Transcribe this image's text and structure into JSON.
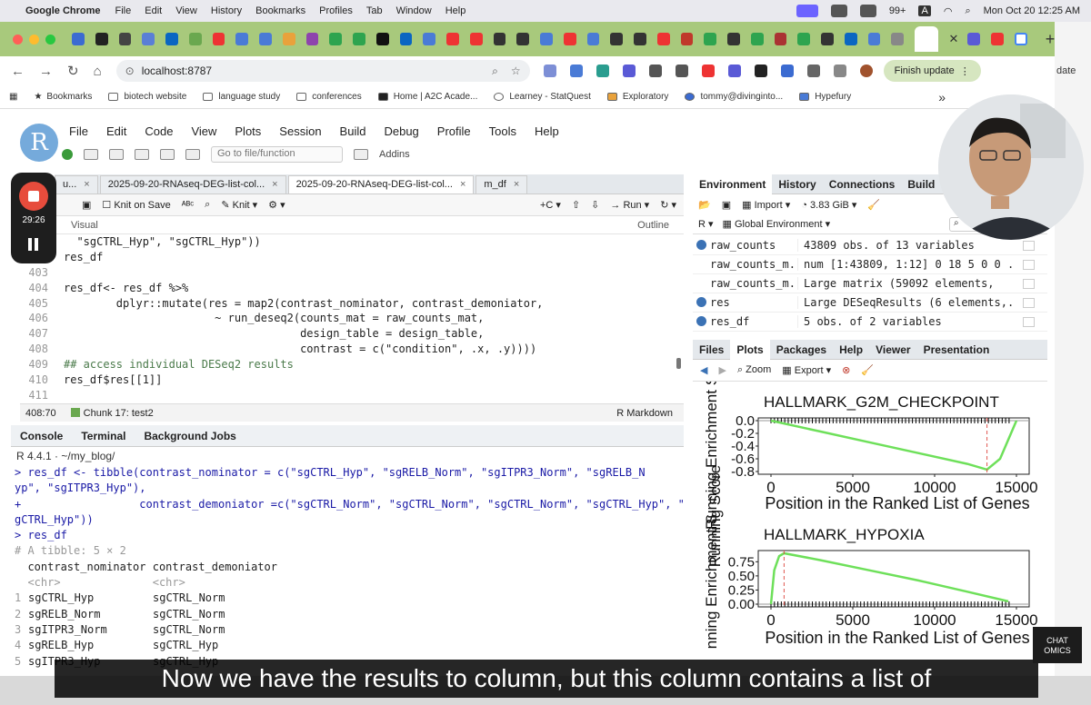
{
  "macbar": {
    "app": "Google Chrome",
    "menus": [
      "File",
      "Edit",
      "View",
      "History",
      "Bookmarks",
      "Profiles",
      "Tab",
      "Window",
      "Help"
    ],
    "notif_count": "99+",
    "input_source": "A",
    "datetime": "Mon Oct 20  12:25 AM"
  },
  "chrome": {
    "url": "localhost:8787",
    "finish_update": "Finish update",
    "partial_right": "date",
    "bookmarks": [
      "Bookmarks",
      "biotech website",
      "language study",
      "conferences",
      "Home | A2C Acade...",
      "Learney - StatQuest",
      "Exploratory",
      "tommy@divinginto...",
      "Hypefury"
    ],
    "more": "»"
  },
  "rstudio": {
    "menus": [
      "File",
      "Edit",
      "Code",
      "View",
      "Plots",
      "Session",
      "Build",
      "Debug",
      "Profile",
      "Tools",
      "Help"
    ],
    "goto_placeholder": "Go to file/function",
    "addins": "Addins",
    "source_tabs": [
      "u...",
      "2025-09-20-RNAseq-DEG-list-col...",
      "2025-09-20-RNAseq-DEG-list-col...",
      "m_df"
    ],
    "knit_on_save": "Knit on Save",
    "knit": "Knit",
    "run": "Run",
    "visual": "Visual",
    "outline": "Outline",
    "status_pos": "408:70",
    "status_chunk": "Chunk 17: test2",
    "status_mode": "R Markdown",
    "console_tabs": [
      "Console",
      "Terminal",
      "Background Jobs"
    ],
    "console_path": "R 4.4.1 · ~/my_blog/"
  },
  "code_lines": [
    {
      "n": "",
      "t": "  \"sgCTRL_Hyp\", \"sgCTRL_Hyp\"))"
    },
    {
      "n": "402",
      "t": "res_df"
    },
    {
      "n": "403",
      "t": ""
    },
    {
      "n": "404",
      "t": "res_df<- res_df %>%"
    },
    {
      "n": "405",
      "t": "        dplyr::mutate(res = map2(contrast_nominator, contrast_demoniator,"
    },
    {
      "n": "406",
      "t": "                       ~ run_deseq2(counts_mat = raw_counts_mat,"
    },
    {
      "n": "407",
      "t": "                                    design_table = design_table,"
    },
    {
      "n": "408",
      "t": "                                    contrast = c(\"condition\", .x, .y))))"
    },
    {
      "n": "409",
      "t": "## access individual DESeq2 results"
    },
    {
      "n": "410",
      "t": "res_df$res[[1]]"
    },
    {
      "n": "411",
      "t": ""
    }
  ],
  "console_lines": [
    {
      "t": "> res_df <- tibble(contrast_nominator = c(\"sgCTRL_Hyp\", \"sgRELB_Norm\", \"sgITPR3_Norm\", \"sgRELB_N",
      "c": "blue"
    },
    {
      "t": "yp\", \"sgITPR3_Hyp\"),",
      "c": "blue"
    },
    {
      "t": "+                  contrast_demoniator =c(\"sgCTRL_Norm\", \"sgCTRL_Norm\", \"sgCTRL_Norm\", \"sgCTRL_Hyp\", \"s",
      "c": "blue"
    },
    {
      "t": "gCTRL_Hyp\"))",
      "c": "blue"
    },
    {
      "t": "> res_df",
      "c": "blue"
    },
    {
      "t": "# A tibble: 5 × 2",
      "c": "gray"
    },
    {
      "t": "  contrast_nominator contrast_demoniator",
      "c": ""
    },
    {
      "t": "  <chr>              <chr>",
      "c": "gray"
    }
  ],
  "tibble_rows": [
    [
      "1",
      "sgCTRL_Hyp",
      "sgCTRL_Norm"
    ],
    [
      "2",
      "sgRELB_Norm",
      "sgCTRL_Norm"
    ],
    [
      "3",
      "sgITPR3_Norm",
      "sgCTRL_Norm"
    ],
    [
      "4",
      "sgRELB_Hyp",
      "sgCTRL_Hyp"
    ],
    [
      "5",
      "sgITPR3_Hyp",
      "sgCTRL_Hyp"
    ]
  ],
  "environment": {
    "tabs": [
      "Environment",
      "History",
      "Connections",
      "Build"
    ],
    "import": "Import",
    "memory": "3.83 GiB",
    "lang": "R",
    "scope": "Global Environment",
    "rows": [
      {
        "name": "raw_counts",
        "value": "43809 obs. of 13 variables"
      },
      {
        "name": "raw_counts_m...",
        "value": "num [1:43809, 1:12] 0 18 5 0 0 ..."
      },
      {
        "name": "raw_counts_m...",
        "value": "Large matrix (59092 elements,"
      },
      {
        "name": "res",
        "value": "Large DESeqResults (6 elements,..."
      },
      {
        "name": "res_df",
        "value": "5 obs. of 2 variables"
      }
    ]
  },
  "plots": {
    "tabs": [
      "Files",
      "Plots",
      "Packages",
      "Help",
      "Viewer",
      "Presentation"
    ],
    "zoom": "Zoom",
    "export": "Export",
    "ylabel_top": "Running Enrichment S",
    "ylabel_bottom": "nning Enrichment S",
    "overlap_label": "Running Score",
    "xlabel": "Position in the Ranked List of Genes"
  },
  "chart_data": [
    {
      "type": "line",
      "title": "HALLMARK_G2M_CHECKPOINT",
      "xlabel": "Position in the Ranked List of Genes",
      "ylabel": "Running Enrichment S",
      "xlim": [
        0,
        15000
      ],
      "ylim": [
        -0.8,
        0.0
      ],
      "xticks": [
        0,
        5000,
        10000,
        15000
      ],
      "yticks": [
        0.0,
        -0.2,
        -0.4,
        -0.6,
        -0.8
      ],
      "ytick_labels": [
        "0.0",
        "-0.2",
        "-0.4",
        "-0.6",
        "-0.8"
      ],
      "line_color": "#6ee05a",
      "x": [
        0,
        3000,
        6000,
        9000,
        12000,
        13200,
        14000,
        14500,
        15000
      ],
      "y": [
        0.0,
        -0.17,
        -0.34,
        -0.51,
        -0.68,
        -0.77,
        -0.6,
        -0.3,
        0.0
      ],
      "peak_x": 13200
    },
    {
      "type": "line",
      "title": "HALLMARK_HYPOXIA",
      "xlabel": "Position in the Ranked List of Genes",
      "ylabel": "nning Enrichment S",
      "xlim": [
        0,
        15000
      ],
      "ylim": [
        0.0,
        0.9
      ],
      "xticks": [
        0,
        5000,
        10000,
        15000
      ],
      "yticks": [
        0.0,
        0.25,
        0.5,
        0.75
      ],
      "ytick_labels": [
        "0.00",
        "0.25",
        "0.50",
        "0.75"
      ],
      "line_color": "#6ee05a",
      "x": [
        0,
        200,
        500,
        800,
        3000,
        6000,
        9000,
        12000,
        14500
      ],
      "y": [
        0.0,
        0.6,
        0.85,
        0.9,
        0.78,
        0.6,
        0.42,
        0.22,
        0.05
      ],
      "peak_x": 800
    }
  ],
  "recording": {
    "time": "29:26"
  },
  "subtitle": "Now we have the results to column, but this column contains a list of",
  "logo": {
    "line1": "CHAT",
    "line2": "OMICS"
  }
}
